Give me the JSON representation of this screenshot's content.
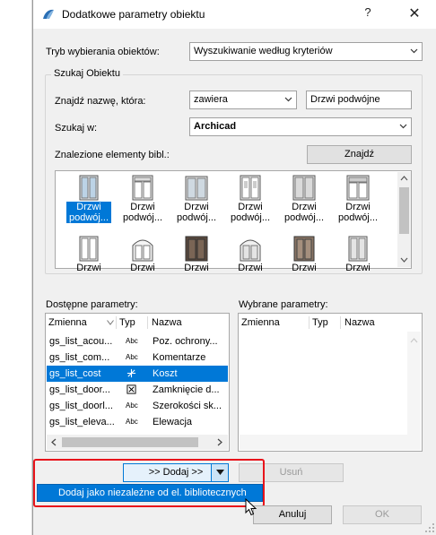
{
  "window": {
    "title": "Dodatkowe parametry obiektu",
    "help": "?",
    "close": "✕"
  },
  "search_mode": {
    "label": "Tryb wybierania obiektów:",
    "value": "Wyszukiwanie według kryteriów"
  },
  "find_group": {
    "title": "Szukaj Obiektu",
    "name_label": "Znajdź nazwę, która:",
    "name_condition": "zawiera",
    "name_value": "Drzwi podwójne",
    "search_in_label": "Szukaj w:",
    "search_in_value": "Archicad",
    "found_label": "Znalezione elementy bibl.:",
    "find_button": "Znajdź"
  },
  "thumbnails": [
    {
      "l1": "Drzwi",
      "l2": "podwój...",
      "selected": true
    },
    {
      "l1": "Drzwi",
      "l2": "podwój..."
    },
    {
      "l1": "Drzwi",
      "l2": "podwój..."
    },
    {
      "l1": "Drzwi",
      "l2": "podwój..."
    },
    {
      "l1": "Drzwi",
      "l2": "podwój..."
    },
    {
      "l1": "Drzwi",
      "l2": "podwój..."
    },
    {
      "l1": "Drzwi",
      "l2": ""
    },
    {
      "l1": "Drzwi",
      "l2": ""
    },
    {
      "l1": "Drzwi",
      "l2": ""
    },
    {
      "l1": "Drzwi",
      "l2": ""
    },
    {
      "l1": "Drzwi",
      "l2": ""
    },
    {
      "l1": "Drzwi",
      "l2": ""
    }
  ],
  "available": {
    "title": "Dostępne parametry:",
    "col_name": "Zmienna",
    "col_type": "Typ",
    "col_desc": "Nazwa",
    "rows": [
      {
        "name": "gs_list_acou...",
        "type": "Abc",
        "desc": "Poz. ochrony..."
      },
      {
        "name": "gs_list_com...",
        "type": "Abc",
        "desc": "Komentarze"
      },
      {
        "name": "gs_list_cost",
        "type": "cost-icon",
        "desc": "Koszt",
        "selected": true
      },
      {
        "name": "gs_list_door...",
        "type": "checkbox-icon",
        "desc": "Zamknięcie d..."
      },
      {
        "name": "gs_list_doorl...",
        "type": "Abc",
        "desc": "Szerokości sk..."
      },
      {
        "name": "gs_list_eleva...",
        "type": "Abc",
        "desc": "Elewacja"
      }
    ]
  },
  "selected": {
    "title": "Wybrane parametry:",
    "col_name": "Zmienna",
    "col_type": "Typ",
    "col_desc": "Nazwa"
  },
  "add_button": ">> Dodaj >>",
  "remove_button": "Usuń",
  "dropdown_item": "Dodaj jako niezależne od el. bibliotecznych",
  "cancel_button": "Anuluj",
  "ok_button": "OK",
  "colors": {
    "accent": "#0078d7",
    "highlight_box": "#e8141b"
  }
}
